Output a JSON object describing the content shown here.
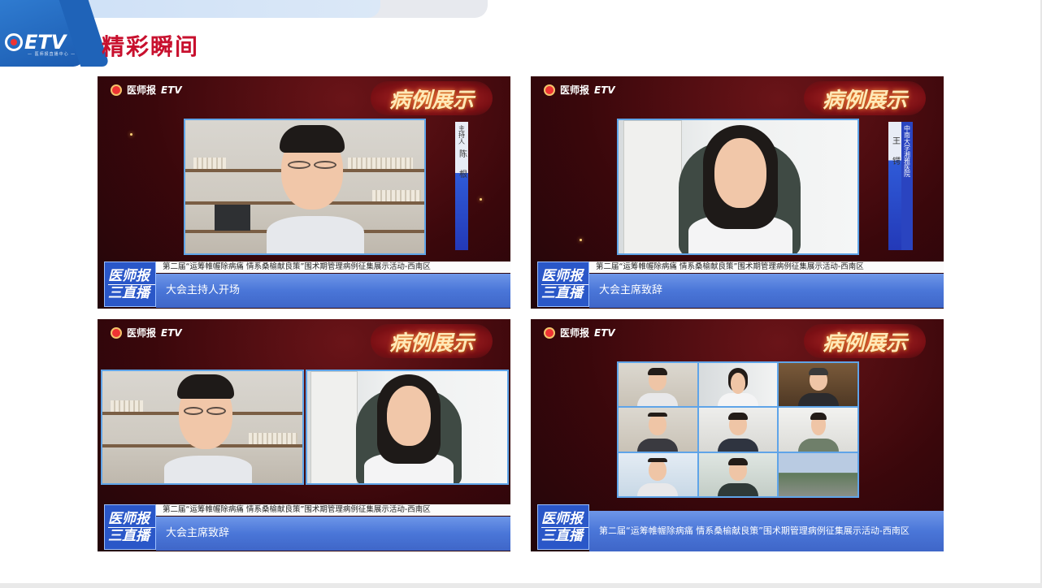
{
  "header": {
    "logo_text": "ETV",
    "logo_sub": "— 医师报直播中心 —",
    "title": "精彩瞬间"
  },
  "colors": {
    "title_red": "#c8102e",
    "accent_blue": "#1f63b8",
    "panel_bg": "#3a070b",
    "lower_third_blue": "#4a76d8"
  },
  "broadcast": {
    "brand_cn": "医师报",
    "brand_etv": "ETV",
    "badge": "病例展示",
    "event_title": "第二届“运筹帷幄除病痛 情系桑榆献良策”围术期管理病例征集展示活动-西南区",
    "live_logo_top": "医师报",
    "live_logo_bottom": "三直播"
  },
  "panels": [
    {
      "caption": "大会主持人开场",
      "namebar": {
        "role": "主持人",
        "name": "陈 根"
      }
    },
    {
      "caption": "大会主席致辞",
      "namebar": {
        "org": "中南大学湘雅医院",
        "name": "王 锷"
      }
    },
    {
      "caption": "大会主席致辞"
    },
    {
      "caption": "第二届“运筹帷幄除病痛 情系桑榆献良策”围术期管理病例征集展示活动-西南区"
    }
  ]
}
